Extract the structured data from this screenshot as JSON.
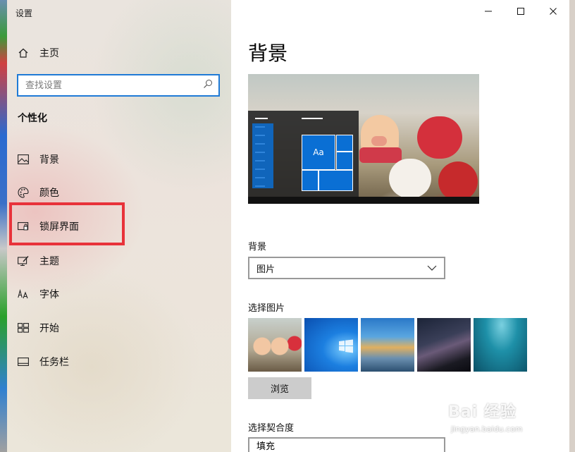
{
  "window": {
    "title": "设置"
  },
  "nav": {
    "home_label": "主页",
    "search_placeholder": "查找设置",
    "section_title": "个性化",
    "items": [
      {
        "label": "背景",
        "icon": "image-icon"
      },
      {
        "label": "颜色",
        "icon": "palette-icon"
      },
      {
        "label": "锁屏界面",
        "icon": "lock-screen-icon"
      },
      {
        "label": "主题",
        "icon": "theme-icon"
      },
      {
        "label": "字体",
        "icon": "font-icon"
      },
      {
        "label": "开始",
        "icon": "start-icon"
      },
      {
        "label": "任务栏",
        "icon": "taskbar-icon"
      }
    ],
    "highlighted_item": "锁屏界面"
  },
  "content": {
    "page_title": "背景",
    "preview_tile_text": "Aa",
    "background_label": "背景",
    "background_value": "图片",
    "choose_picture_label": "选择图片",
    "browse_label": "浏览",
    "fit_label": "选择契合度",
    "fit_value": "填充"
  },
  "watermark": {
    "top": "Bai 经验",
    "bottom": "jingyan.baidu.com"
  },
  "colors": {
    "accent": "#0078d7",
    "highlight": "#e8323a"
  }
}
